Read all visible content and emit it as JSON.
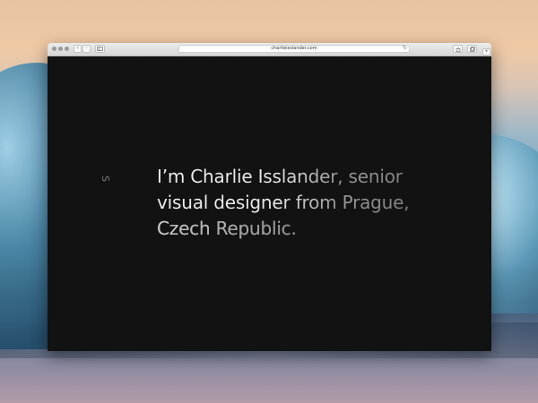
{
  "browser": {
    "url": "charlieisslander.com",
    "toolbar": {
      "back_icon": "chevron-left-icon",
      "forward_icon": "chevron-right-icon",
      "sidebar_icon": "sidebar-icon",
      "reload_icon": "reload-icon",
      "share_icon": "share-icon",
      "tabs_icon": "tabs-icon",
      "new_tab_icon": "plus-icon"
    }
  },
  "page": {
    "logo_glyph": "S",
    "headline": {
      "line1": "I’m Charlie Isslander, senior",
      "line2": "visual designer from Prague,",
      "line3": "Czech Republic."
    },
    "background_color": "#121212"
  }
}
